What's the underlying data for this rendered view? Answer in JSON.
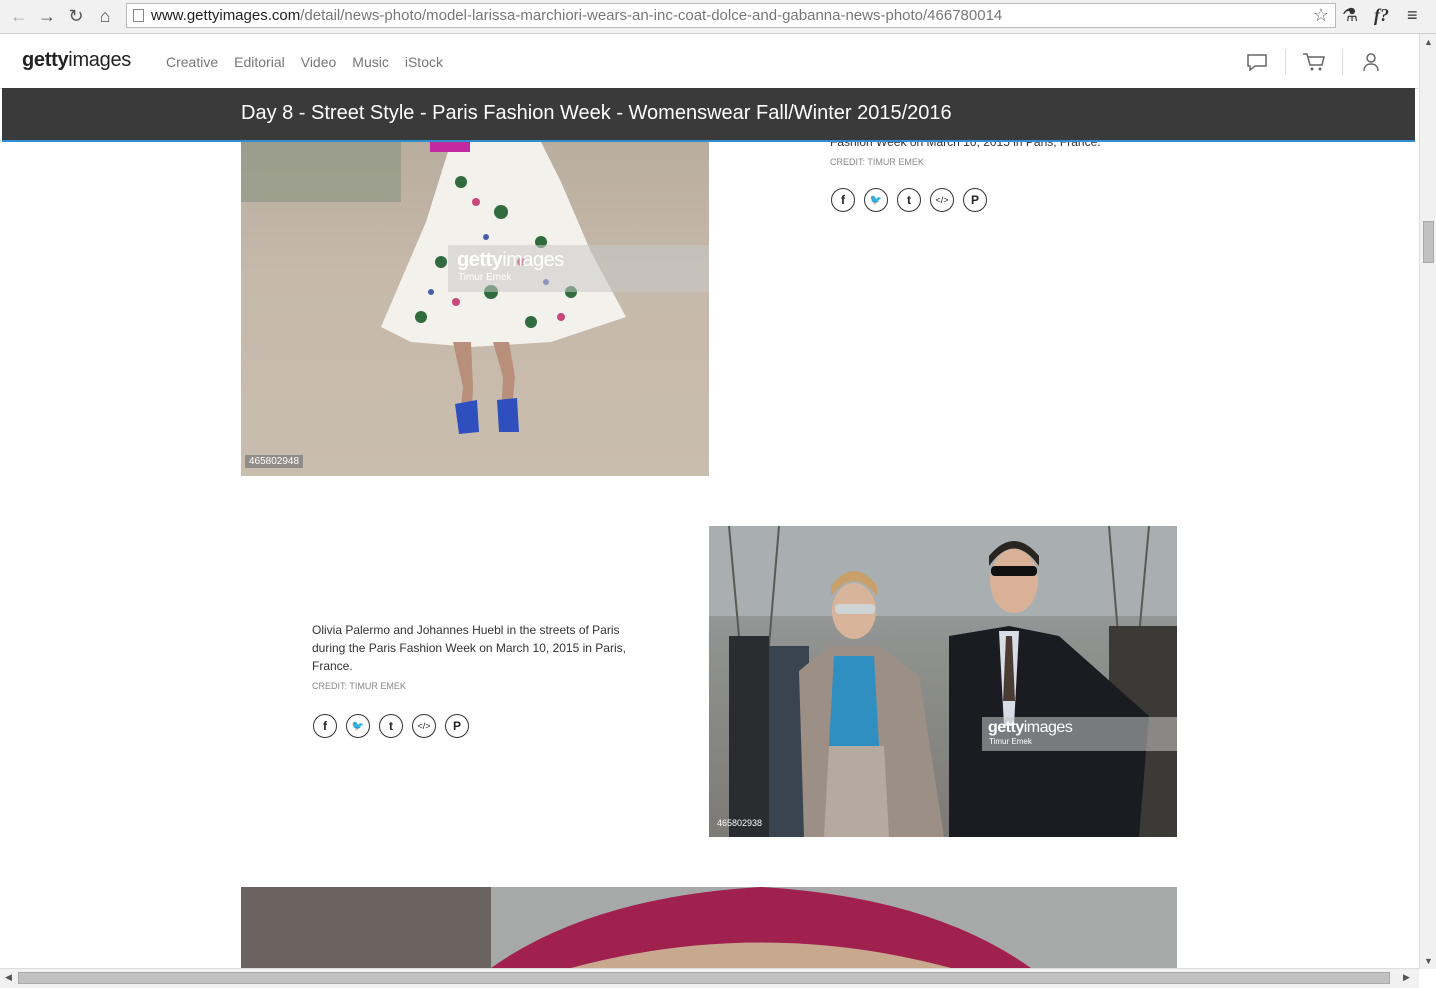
{
  "browser": {
    "url_host": "www.gettyimages.com",
    "url_path": "/detail/news-photo/model-larissa-marchiori-wears-an-inc-coat-dolce-and-gabanna-news-photo/466780014",
    "ext1": "⚗",
    "ext2": "f?"
  },
  "header": {
    "logo_bold": "getty",
    "logo_rest": "images",
    "nav": [
      "Creative",
      "Editorial",
      "Video",
      "Music",
      "iStock"
    ]
  },
  "title": "Day 8 - Street Style - Paris Fashion Week - Womenswear Fall/Winter 2015/2016",
  "photo1": {
    "id": "465802948",
    "wm_brand_bold": "getty",
    "wm_brand_rest": "images",
    "wm_author": "Timur Emek",
    "caption_partial": "Fashion Week on March 10, 2015 in Paris, France.",
    "credit": "CREDIT: TIMUR EMEK"
  },
  "photo2": {
    "id": "465802938",
    "wm_brand_bold": "getty",
    "wm_brand_rest": "images",
    "wm_author": "Timur Emek",
    "caption_lines": [
      "Olivia Palermo and Johannes Huebl in the streets of Paris",
      "during the Paris Fashion Week on March 10, 2015 in Paris,",
      "France."
    ],
    "credit": "CREDIT: TIMUR EMEK"
  },
  "share": {
    "facebook": "f",
    "twitter": "🐦",
    "tumblr": "t",
    "embed": "</>",
    "pinterest": "P"
  },
  "colors": {
    "titlebar": "#3a3a3a",
    "accent": "#2e8fd0"
  }
}
